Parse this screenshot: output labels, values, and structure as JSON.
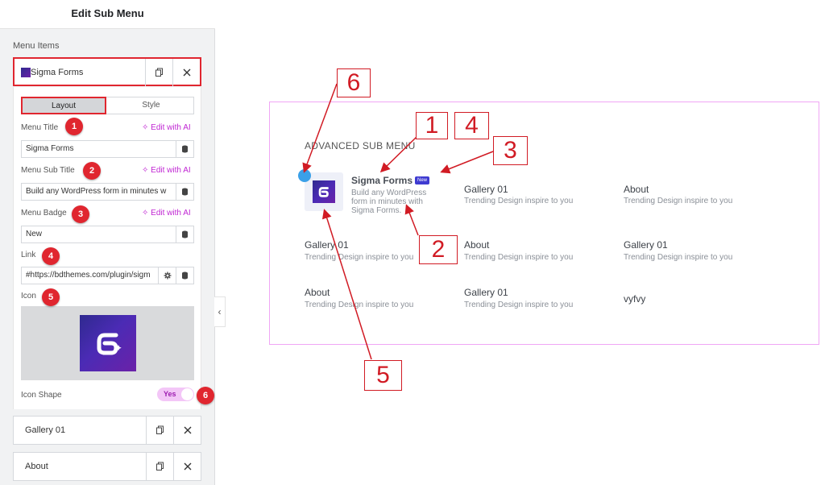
{
  "panel": {
    "title": "Edit Sub Menu",
    "menu_items_label": "Menu Items",
    "items": [
      {
        "label": "Sigma Forms",
        "expanded": true
      },
      {
        "label": "Gallery 01"
      },
      {
        "label": "About"
      }
    ],
    "tabs": [
      "Layout",
      "Style"
    ],
    "fields": {
      "menu_title": {
        "label": "Menu Title",
        "value": "Sigma Forms",
        "ai": "Edit with AI"
      },
      "menu_sub_title": {
        "label": "Menu Sub Title",
        "value": "Build any WordPress form in minutes w",
        "ai": "Edit with AI"
      },
      "menu_badge": {
        "label": "Menu Badge",
        "value": "New",
        "ai": "Edit with AI"
      },
      "link": {
        "label": "Link",
        "value": "#https://bdthemes.com/plugin/sigm"
      },
      "icon": {
        "label": "Icon"
      },
      "icon_shape": {
        "label": "Icon Shape",
        "value": "Yes"
      }
    },
    "collapse_glyph": "‹"
  },
  "preview": {
    "heading": "ADVANCED SUB MENU",
    "featured": {
      "title": "Sigma Forms",
      "badge": "New",
      "subtitle_lines": [
        "Build any WordPress",
        "form in minutes with",
        "Sigma Forms."
      ]
    },
    "cells": [
      {
        "title": "Gallery 01",
        "subtitle": "Trending Design inspire to you"
      },
      {
        "title": "About",
        "subtitle": "Trending Design inspire to you"
      },
      {
        "title": "Gallery 01",
        "subtitle": "Trending Design inspire to you"
      },
      {
        "title": "About",
        "subtitle": "Trending Design inspire to you"
      },
      {
        "title": "Gallery 01",
        "subtitle": "Trending Design inspire to you"
      },
      {
        "title": "About",
        "subtitle": "Trending Design inspire to you"
      },
      {
        "title": "Gallery 01",
        "subtitle": "Trending Design inspire to you"
      },
      {
        "title": "vyfvy",
        "subtitle": ""
      }
    ]
  },
  "step_badges": [
    "1",
    "2",
    "3",
    "4",
    "5",
    "6"
  ],
  "callouts": [
    "1",
    "2",
    "3",
    "4",
    "5",
    "6"
  ],
  "colors": {
    "accent": "#e0262f",
    "ai": "#c026d3",
    "preview_border": "#f0a6f5",
    "badge_new": "#3f3bd1"
  },
  "icons": {
    "copy": "copy-icon",
    "close": "close-icon",
    "database": "database-icon",
    "settings": "gear-icon",
    "ai": "sparkle-icon"
  }
}
